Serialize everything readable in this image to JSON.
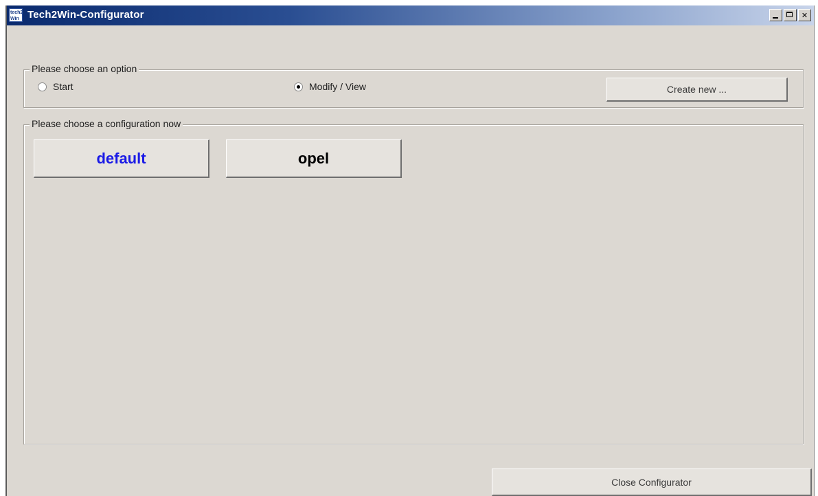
{
  "window": {
    "title": "Tech2Win-Configurator",
    "icon_text_line1": "tech2",
    "icon_text_line2": "Win",
    "caption_buttons": [
      "minimize-icon",
      "maximize-icon",
      "close-icon"
    ]
  },
  "options_group": {
    "legend": "Please choose an option",
    "radios": [
      {
        "label": "Start",
        "checked": false
      },
      {
        "label": "Modify / View",
        "checked": true
      }
    ],
    "create_button_label": "Create new ..."
  },
  "config_group": {
    "legend": "Please choose a configuration now",
    "configurations": [
      {
        "label": "default",
        "color": "#1a1ae6"
      },
      {
        "label": "opel",
        "color": "#000000"
      }
    ]
  },
  "footer": {
    "close_button_label": "Close Configurator"
  },
  "colors": {
    "window_bg": "#dcd8d2",
    "title_bar_start": "#0a2a6e",
    "title_bar_end": "#c8d4ea"
  }
}
